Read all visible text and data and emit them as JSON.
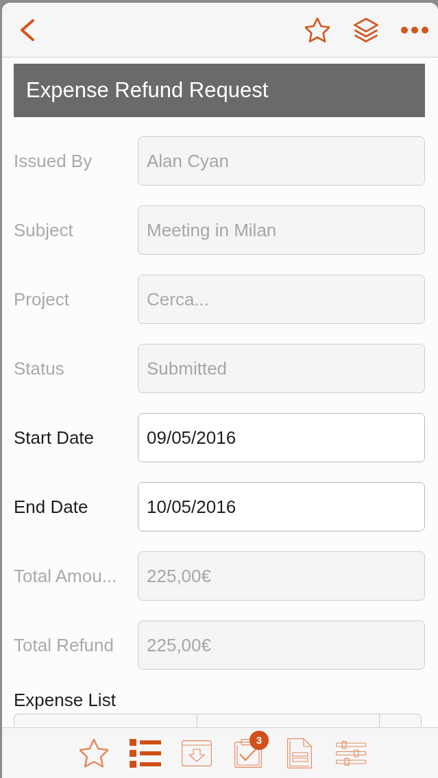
{
  "title": "Expense Refund Request",
  "fields": [
    {
      "label": "Issued By",
      "value": "Alan Cyan",
      "disabled": true
    },
    {
      "label": "Subject",
      "value": "Meeting in Milan",
      "disabled": true
    },
    {
      "label": "Project",
      "placeholder": "Cerca...",
      "disabled": true
    },
    {
      "label": "Status",
      "value": "Submitted",
      "disabled": true
    },
    {
      "label": "Start Date",
      "value": "09/05/2016",
      "disabled": false
    },
    {
      "label": "End Date",
      "value": "10/05/2016",
      "disabled": false
    },
    {
      "label": "Total Amou...",
      "value": "225,00€",
      "disabled": true
    },
    {
      "label": "Total Refund",
      "value": "225,00€",
      "disabled": true
    }
  ],
  "expense_list": {
    "title": "Expense List"
  },
  "tabs": [
    {
      "kind": "favorites",
      "selected": false
    },
    {
      "kind": "list",
      "selected": true
    },
    {
      "kind": "inbox",
      "selected": false
    },
    {
      "kind": "tasks",
      "selected": false,
      "badge": "3"
    },
    {
      "kind": "document",
      "selected": false
    },
    {
      "kind": "settings",
      "selected": false
    }
  ]
}
